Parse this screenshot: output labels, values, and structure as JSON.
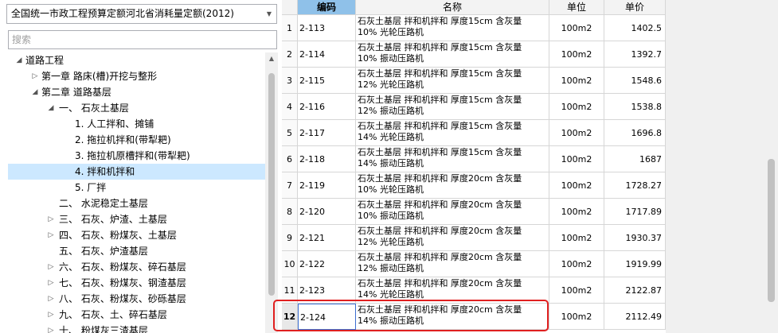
{
  "quota_selector": {
    "value": "全国统一市政工程预算定额河北省消耗量定额(2012)",
    "arrow_icon": "chevron-down-icon"
  },
  "search": {
    "placeholder": "搜索"
  },
  "tree": [
    {
      "label": "道路工程",
      "level": 0,
      "toggle": "◢",
      "selected": false
    },
    {
      "label": "第一章 路床(槽)开挖与整形",
      "level": 1,
      "toggle": "▷",
      "selected": false
    },
    {
      "label": "第二章 道路基层",
      "level": 1,
      "toggle": "◢",
      "selected": false
    },
    {
      "label": "一、 石灰土基层",
      "level": 2,
      "toggle": "◢",
      "selected": false
    },
    {
      "label": "1. 人工拌和、摊铺",
      "level": 3,
      "toggle": "",
      "selected": false
    },
    {
      "label": "2. 拖拉机拌和(带犁耙)",
      "level": 3,
      "toggle": "",
      "selected": false
    },
    {
      "label": "3. 拖拉机原槽拌和(带犁耙)",
      "level": 3,
      "toggle": "",
      "selected": false
    },
    {
      "label": "4. 拌和机拌和",
      "level": 3,
      "toggle": "",
      "selected": true
    },
    {
      "label": "5. 厂拌",
      "level": 3,
      "toggle": "",
      "selected": false
    },
    {
      "label": "二、 水泥稳定土基层",
      "level": 2,
      "toggle": "",
      "selected": false
    },
    {
      "label": "三、 石灰、炉渣、土基层",
      "level": 2,
      "toggle": "▷",
      "selected": false
    },
    {
      "label": "四、 石灰、粉煤灰、土基层",
      "level": 2,
      "toggle": "▷",
      "selected": false
    },
    {
      "label": "五、 石灰、炉渣基层",
      "level": 2,
      "toggle": "",
      "selected": false
    },
    {
      "label": "六、 石灰、粉煤灰、碎石基层",
      "level": 2,
      "toggle": "▷",
      "selected": false
    },
    {
      "label": "七、 石灰、粉煤灰、钢渣基层",
      "level": 2,
      "toggle": "▷",
      "selected": false
    },
    {
      "label": "八、 石灰、粉煤灰、砂砾基层",
      "level": 2,
      "toggle": "▷",
      "selected": false
    },
    {
      "label": "九、 石灰、土、碎石基层",
      "level": 2,
      "toggle": "▷",
      "selected": false
    },
    {
      "label": "十、 粉煤灰三渣基层",
      "level": 2,
      "toggle": "▷",
      "selected": false
    }
  ],
  "table": {
    "headers": {
      "code": "编码",
      "name": "名称",
      "unit": "单位",
      "price": "单价"
    },
    "rows": [
      {
        "idx": "1",
        "code": "2-113",
        "name1": "石灰土基层 拌和机拌和 厚度15cm 含灰量",
        "name2": "10% 光轮压路机",
        "unit": "100m2",
        "price": "1402.5"
      },
      {
        "idx": "2",
        "code": "2-114",
        "name1": "石灰土基层 拌和机拌和 厚度15cm 含灰量",
        "name2": "10% 振动压路机",
        "unit": "100m2",
        "price": "1392.7"
      },
      {
        "idx": "3",
        "code": "2-115",
        "name1": "石灰土基层 拌和机拌和 厚度15cm 含灰量",
        "name2": "12% 光轮压路机",
        "unit": "100m2",
        "price": "1548.6"
      },
      {
        "idx": "4",
        "code": "2-116",
        "name1": "石灰土基层 拌和机拌和 厚度15cm 含灰量",
        "name2": "12% 振动压路机",
        "unit": "100m2",
        "price": "1538.8"
      },
      {
        "idx": "5",
        "code": "2-117",
        "name1": "石灰土基层 拌和机拌和 厚度15cm 含灰量",
        "name2": "14% 光轮压路机",
        "unit": "100m2",
        "price": "1696.8"
      },
      {
        "idx": "6",
        "code": "2-118",
        "name1": "石灰土基层 拌和机拌和 厚度15cm 含灰量",
        "name2": "14% 振动压路机",
        "unit": "100m2",
        "price": "1687"
      },
      {
        "idx": "7",
        "code": "2-119",
        "name1": "石灰土基层 拌和机拌和 厚度20cm 含灰量",
        "name2": "10% 光轮压路机",
        "unit": "100m2",
        "price": "1728.27"
      },
      {
        "idx": "8",
        "code": "2-120",
        "name1": "石灰土基层 拌和机拌和 厚度20cm 含灰量",
        "name2": "10% 振动压路机",
        "unit": "100m2",
        "price": "1717.89"
      },
      {
        "idx": "9",
        "code": "2-121",
        "name1": "石灰土基层 拌和机拌和 厚度20cm 含灰量",
        "name2": "12% 光轮压路机",
        "unit": "100m2",
        "price": "1930.37"
      },
      {
        "idx": "10",
        "code": "2-122",
        "name1": "石灰土基层 拌和机拌和 厚度20cm 含灰量",
        "name2": "12% 振动压路机",
        "unit": "100m2",
        "price": "1919.99"
      },
      {
        "idx": "11",
        "code": "2-123",
        "name1": "石灰土基层 拌和机拌和 厚度20cm 含灰量",
        "name2": "14% 光轮压路机",
        "unit": "100m2",
        "price": "2122.87"
      },
      {
        "idx": "12",
        "code": "2-124",
        "name1": "石灰土基层 拌和机拌和 厚度20cm 含灰量",
        "name2": "14% 振动压路机",
        "unit": "100m2",
        "price": "2112.49"
      }
    ]
  },
  "colors": {
    "selected_tree_bg": "#cce8ff",
    "code_header_bg": "#8fc1e9",
    "highlight_border": "#e02020"
  }
}
